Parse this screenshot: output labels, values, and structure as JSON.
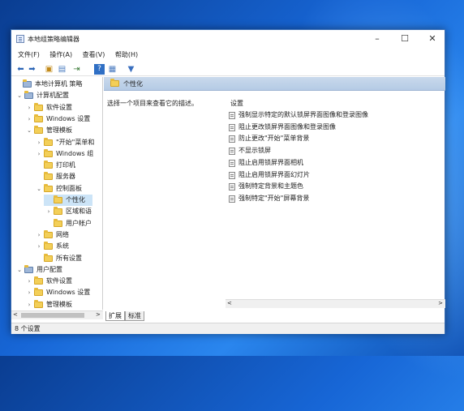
{
  "window": {
    "title": "本地组策略编辑器"
  },
  "menu": [
    "文件(F)",
    "操作(A)",
    "查看(V)",
    "帮助(H)"
  ],
  "tree": [
    {
      "label": "本地计算机 策略",
      "indent": 0,
      "expander": ""
    },
    {
      "label": "计算机配置",
      "indent": 1,
      "expander": "v"
    },
    {
      "label": "软件设置",
      "indent": 2,
      "expander": ">"
    },
    {
      "label": "Windows 设置",
      "indent": 2,
      "expander": ">"
    },
    {
      "label": "管理模板",
      "indent": 2,
      "expander": "v"
    },
    {
      "label": "\"开始\"菜单和",
      "indent": 3,
      "expander": ">"
    },
    {
      "label": "Windows 组",
      "indent": 3,
      "expander": ">"
    },
    {
      "label": "打印机",
      "indent": 3,
      "expander": ""
    },
    {
      "label": "服务器",
      "indent": 3,
      "expander": ""
    },
    {
      "label": "控制面板",
      "indent": 3,
      "expander": "v"
    },
    {
      "label": "个性化",
      "indent": 4,
      "expander": "",
      "selected": true
    },
    {
      "label": "区域和语",
      "indent": 4,
      "expander": ">"
    },
    {
      "label": "用户帐户",
      "indent": 4,
      "expander": ""
    },
    {
      "label": "网络",
      "indent": 3,
      "expander": ">"
    },
    {
      "label": "系统",
      "indent": 3,
      "expander": ">"
    },
    {
      "label": "所有设置",
      "indent": 3,
      "expander": ""
    },
    {
      "label": "用户配置",
      "indent": 1,
      "expander": "v"
    },
    {
      "label": "软件设置",
      "indent": 2,
      "expander": ">"
    },
    {
      "label": "Windows 设置",
      "indent": 2,
      "expander": ">"
    },
    {
      "label": "管理模板",
      "indent": 2,
      "expander": ">"
    }
  ],
  "right": {
    "header": "个性化",
    "description": "选择一个项目来查看它的描述。",
    "settings_header": "设置",
    "settings": [
      "强制显示特定的默认锁屏界面图像和登录图像",
      "阻止更改锁屏界面图像和登录图像",
      "防止更改\"开始\"菜单背景",
      "不显示锁屏",
      "阻止启用锁屏界面相机",
      "阻止启用锁屏界面幻灯片",
      "强制特定背景和主题色",
      "强制特定\"开始\"屏幕背景"
    ]
  },
  "tabs": [
    "扩展",
    "标准"
  ],
  "status": "8 个设置"
}
